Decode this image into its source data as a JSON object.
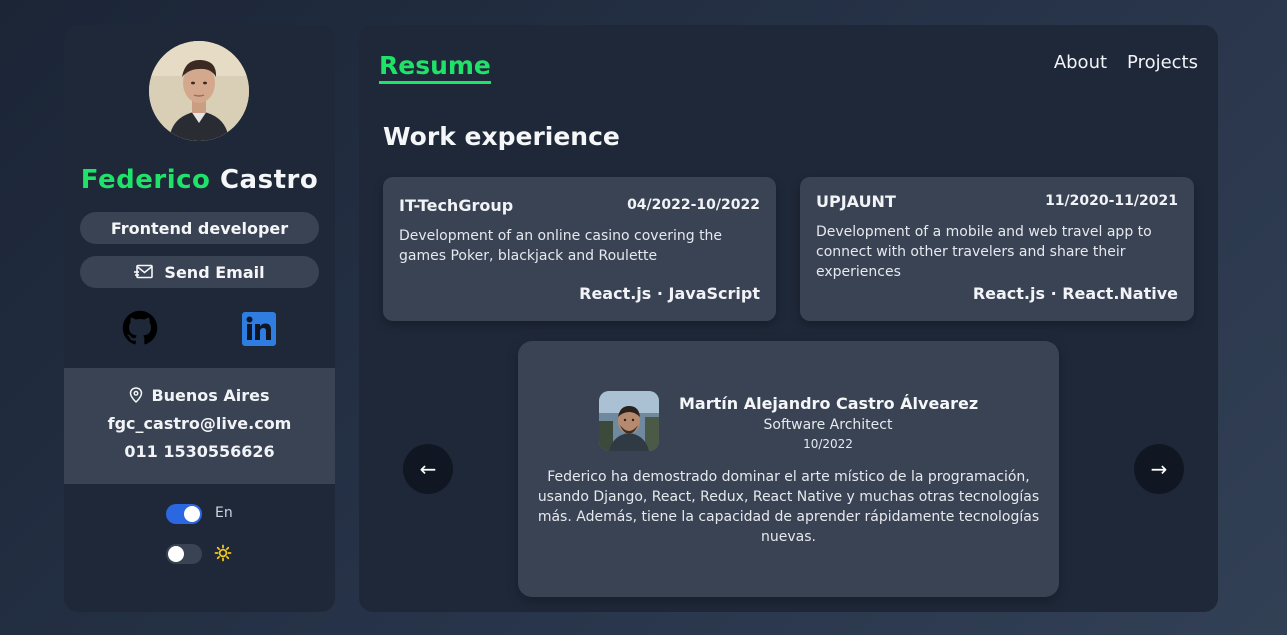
{
  "profile": {
    "first_name": "Federico",
    "last_name": "Castro",
    "role": "Frontend developer",
    "send_email_label": "Send Email",
    "location": "Buenos Aires",
    "email": "fgc_castro@live.com",
    "phone": "011 1530556626"
  },
  "settings": {
    "language_label": "En",
    "language_toggle_on": true,
    "theme_toggle_on": false
  },
  "nav": {
    "active_tab": "Resume",
    "links": [
      "About",
      "Projects"
    ]
  },
  "work": {
    "title": "Work experience",
    "jobs": [
      {
        "company": "IT-TechGroup",
        "dates": "04/2022-10/2022",
        "description": "Development of an online casino covering the games Poker, blackjack and Roulette",
        "tech": "React.js · JavaScript"
      },
      {
        "company": "UPJAUNT",
        "dates": "11/2020-11/2021",
        "description": "Development of a mobile and web travel app to connect with other travelers and share their experiences",
        "tech": "React.js · React.Native"
      }
    ]
  },
  "testimonial": {
    "name": "Martín Alejandro Castro Álvearez",
    "role": "Software Architect",
    "date": "10/2022",
    "quote": "Federico ha demostrado dominar el arte místico de la programación, usando Django, React, Redux, React Native y muchas otras tecnologías más. Además, tiene la capacidad de aprender rápidamente tecnologías nuevas.",
    "prev_label": "←",
    "next_label": "→"
  },
  "colors": {
    "accent": "#1ee368",
    "panel": "#1f2839",
    "card": "#3a4354",
    "toggle_on": "#2a67e0",
    "linkedin": "#2f7de0"
  },
  "icons": [
    "mail-icon",
    "github-icon",
    "linkedin-icon",
    "location-pin-icon",
    "sun-icon",
    "arrow-left-icon",
    "arrow-right-icon"
  ]
}
